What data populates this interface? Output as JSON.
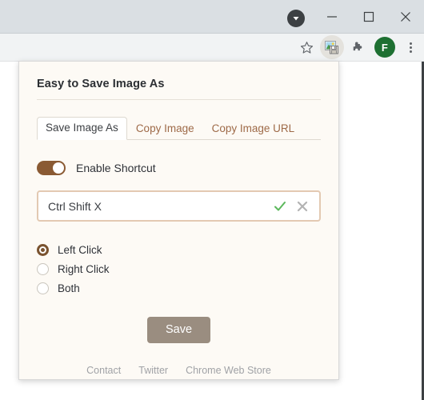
{
  "window": {
    "controls": {
      "collapse_tabs_icon": "chevron-down-circle-icon",
      "minimize_label": "—",
      "maximize_label": "□",
      "close_label": "✕"
    }
  },
  "toolbar": {
    "bookmark_icon": "star-icon",
    "extension_icon": "save-image-extension-icon",
    "extensions_icon": "puzzle-piece-icon",
    "profile_initial": "F",
    "menu_icon": "three-dot-menu-icon"
  },
  "popup": {
    "title": "Easy to Save Image As",
    "tabs": [
      {
        "label": "Save Image As",
        "active": true
      },
      {
        "label": "Copy Image",
        "active": false
      },
      {
        "label": "Copy Image URL",
        "active": false
      }
    ],
    "toggle": {
      "label": "Enable Shortcut",
      "state": "on"
    },
    "shortcut": {
      "value": "Ctrl Shift X",
      "placeholder": "Ctrl Shift X",
      "confirm_icon": "check-icon",
      "clear_icon": "close-icon"
    },
    "click_options": [
      {
        "label": "Left Click",
        "selected": true
      },
      {
        "label": "Right Click",
        "selected": false
      },
      {
        "label": "Both",
        "selected": false
      }
    ],
    "save_label": "Save",
    "footer_links": [
      {
        "label": "Contact"
      },
      {
        "label": "Twitter"
      },
      {
        "label": "Chrome Web Store"
      }
    ]
  },
  "colors": {
    "accent_brown": "#8a5a33",
    "tab_inactive": "#9e6a48",
    "save_button": "#9a8d80",
    "popup_bg": "#fdfaf5",
    "avatar_green": "#1e7032",
    "check_green": "#5cb85c"
  }
}
